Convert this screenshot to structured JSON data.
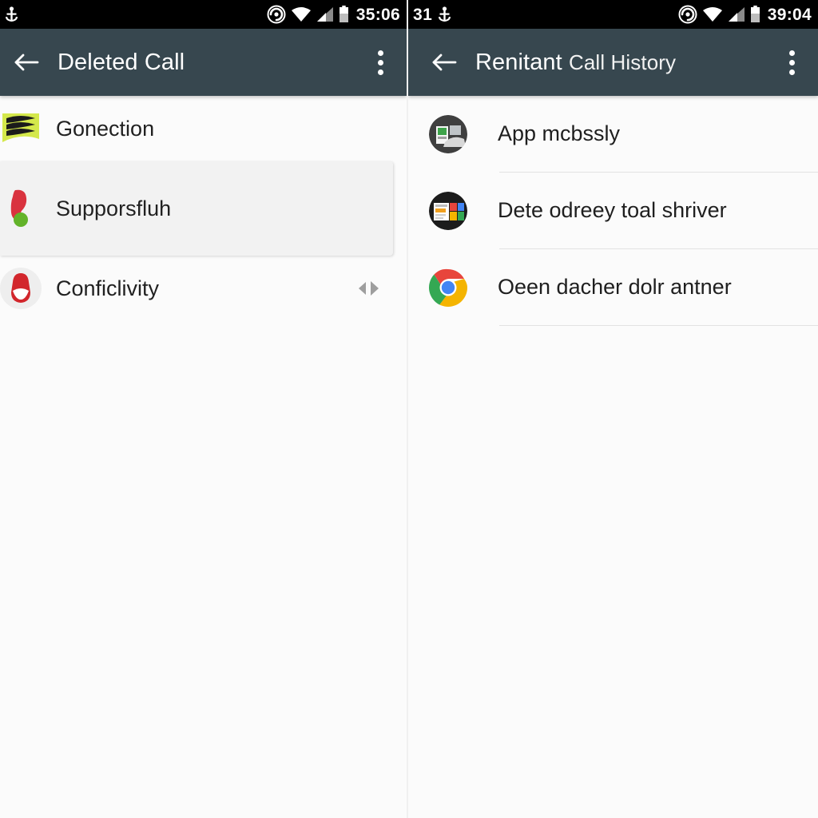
{
  "screens": [
    {
      "id": "left",
      "status_bar": {
        "left_badge": "",
        "icons_left": [
          "anchor-icon"
        ],
        "icons_right": [
          "cast-icon",
          "wifi-icon",
          "signal-icon",
          "battery-icon"
        ],
        "time": "35:06"
      },
      "app_bar": {
        "back_label": "back-arrow",
        "title": "Deleted Call",
        "title_secondary": "",
        "overflow_label": "more-options"
      },
      "list": [
        {
          "label": "Gonection",
          "icon": "chevron-stack-icon",
          "selected": false,
          "handle": false
        },
        {
          "label": "Supporsfluh",
          "icon": "red-phone-icon",
          "selected": true,
          "handle": false
        },
        {
          "label": "Conficlivity",
          "icon": "red-badge-icon",
          "selected": false,
          "handle": true
        }
      ]
    },
    {
      "id": "right",
      "status_bar": {
        "left_badge": "31",
        "icons_left": [
          "anchor-icon"
        ],
        "icons_right": [
          "cast-icon",
          "wifi-icon",
          "signal-icon",
          "battery-icon"
        ],
        "time": "39:04"
      },
      "app_bar": {
        "back_label": "back-arrow",
        "title": "Renitant",
        "title_secondary": "Call History",
        "overflow_label": "more-options"
      },
      "list": [
        {
          "label": "App mcbssly",
          "icon": "photos-gallery-icon"
        },
        {
          "label": "Dete odreey toal shriver",
          "icon": "news-cards-icon"
        },
        {
          "label": "Oeen dacher dolr antner",
          "icon": "chrome-icon"
        }
      ]
    }
  ],
  "colors": {
    "app_bar": "#37474f",
    "status_bar": "#000000",
    "page_background": "#fbfbfb",
    "selected_row": "#f2f2f2",
    "divider": "#e2e2e2",
    "primary_text": "#212121",
    "app_bar_text": "#ffffff"
  }
}
